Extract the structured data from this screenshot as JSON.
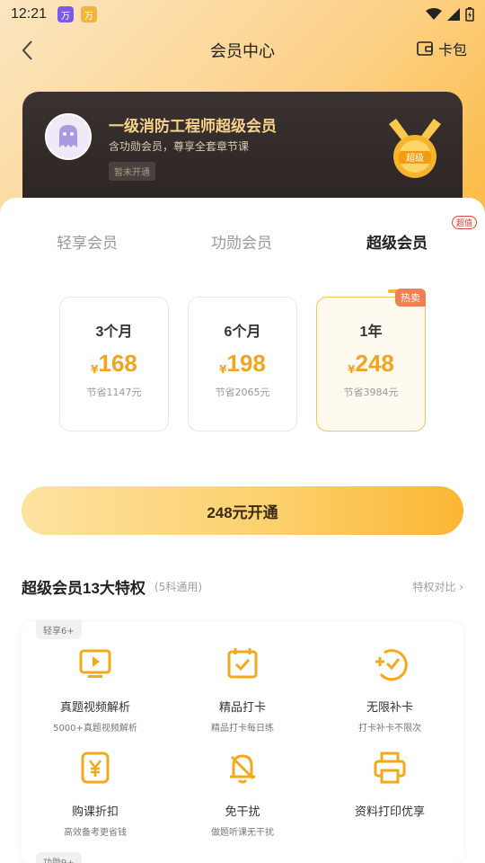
{
  "status": {
    "time": "12:21",
    "app1": "万",
    "app2": "万"
  },
  "header": {
    "title": "会员中心",
    "wallet_label": "卡包"
  },
  "card": {
    "title": "一级消防工程师超级会员",
    "subtitle": "含功勋会员，尊享全套章节课",
    "badge": "暂未开通",
    "medal_text": "超级"
  },
  "tabs": [
    {
      "label": "轻享会员"
    },
    {
      "label": "功勋会员"
    },
    {
      "label": "超级会员",
      "active": true
    }
  ],
  "tabs_badge": "超值",
  "plans": [
    {
      "name": "3个月",
      "currency": "¥",
      "price": "168",
      "save": "节省1147元"
    },
    {
      "name": "6个月",
      "currency": "¥",
      "price": "198",
      "save": "节省2065元"
    },
    {
      "name": "1年",
      "currency": "¥",
      "price": "248",
      "save": "节省3984元",
      "tag": "热卖",
      "selected": true
    }
  ],
  "cta_label": "248元开通",
  "privileges": {
    "title": "超级会员13大特权",
    "note": "(5科通用)",
    "compare": "特权对比",
    "group_tag": "轻享6+",
    "next_group_tag": "功勋9+",
    "items": [
      {
        "name": "真题视频解析",
        "desc": "5000+真题视频解析",
        "icon": "video-play-icon"
      },
      {
        "name": "精品打卡",
        "desc": "精品打卡每日练",
        "icon": "calendar-check-icon"
      },
      {
        "name": "无限补卡",
        "desc": "打卡补卡不限次",
        "icon": "plus-check-icon"
      },
      {
        "name": "购课折扣",
        "desc": "高效备考更省钱",
        "icon": "yen-coupon-icon"
      },
      {
        "name": "免干扰",
        "desc": "做题听课无干扰",
        "icon": "bell-off-icon"
      },
      {
        "name": "资料打印优享",
        "desc": "",
        "icon": "printer-icon"
      }
    ]
  },
  "colors": {
    "accent": "#f5b53a",
    "price": "#f0a520",
    "card_bg": "#2d2624",
    "card_title": "#f7d28a"
  }
}
